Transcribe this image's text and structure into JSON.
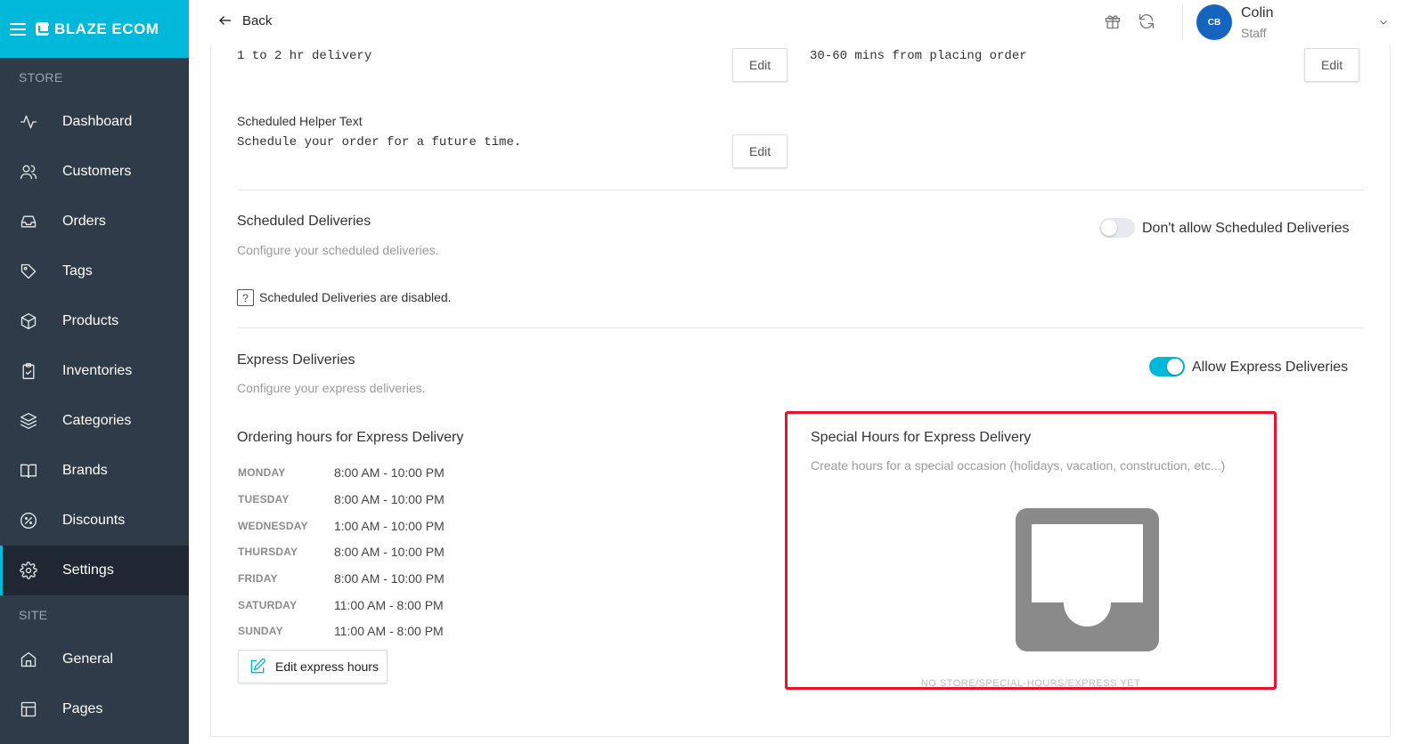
{
  "brand": {
    "name": "BLAZE ECOM"
  },
  "sidebar": {
    "store_label": "STORE",
    "site_label": "SITE",
    "store_items": [
      {
        "label": "Dashboard",
        "icon": "activity-icon"
      },
      {
        "label": "Customers",
        "icon": "users-icon"
      },
      {
        "label": "Orders",
        "icon": "inbox-icon"
      },
      {
        "label": "Tags",
        "icon": "tag-icon"
      },
      {
        "label": "Products",
        "icon": "box-icon"
      },
      {
        "label": "Inventories",
        "icon": "clipboard-check-icon"
      },
      {
        "label": "Categories",
        "icon": "layers-icon"
      },
      {
        "label": "Brands",
        "icon": "book-open-icon"
      },
      {
        "label": "Discounts",
        "icon": "percent-icon"
      },
      {
        "label": "Settings",
        "icon": "gear-icon",
        "active": true
      }
    ],
    "site_items": [
      {
        "label": "General",
        "icon": "home-icon"
      },
      {
        "label": "Pages",
        "icon": "layout-icon"
      }
    ]
  },
  "topbar": {
    "back_label": "Back",
    "user": {
      "initials": "CB",
      "name": "Colin",
      "role": "Staff"
    }
  },
  "content": {
    "top_row": {
      "left_text": "1 to 2 hr delivery",
      "right_text": "30-60 mins from placing order",
      "edit_label": "Edit"
    },
    "scheduled_helper": {
      "label": "Scheduled Helper Text",
      "text": "Schedule your order for a future time.",
      "edit_label": "Edit"
    },
    "scheduled_deliveries": {
      "title": "Scheduled Deliveries",
      "subtitle": "Configure your scheduled deliveries.",
      "toggle_label": "Don't allow Scheduled Deliveries",
      "toggle_on": false,
      "notice": "Scheduled Deliveries are disabled."
    },
    "express_deliveries": {
      "title": "Express Deliveries",
      "subtitle": "Configure your express deliveries.",
      "toggle_label": "Allow Express Deliveries",
      "toggle_on": true
    },
    "ordering_hours": {
      "title": "Ordering hours for Express Delivery",
      "days": [
        {
          "day": "MONDAY",
          "hours": "8:00 AM - 10:00 PM"
        },
        {
          "day": "TUESDAY",
          "hours": "8:00 AM - 10:00 PM"
        },
        {
          "day": "WEDNESDAY",
          "hours": "1:00 AM - 10:00 PM"
        },
        {
          "day": "THURSDAY",
          "hours": "8:00 AM - 10:00 PM"
        },
        {
          "day": "FRIDAY",
          "hours": "8:00 AM - 10:00 PM"
        },
        {
          "day": "SATURDAY",
          "hours": "11:00 AM - 8:00 PM"
        },
        {
          "day": "SUNDAY",
          "hours": "11:00 AM - 8:00 PM"
        }
      ],
      "edit_button": "Edit express hours"
    },
    "special_hours": {
      "title": "Special Hours for Express Delivery",
      "subtitle": "Create hours for a special occasion (holidays, vacation, construction, etc...)",
      "empty_text": "NO STORE/SPECIAL-HOURS/EXPRESS YET"
    }
  },
  "colors": {
    "accent": "#00b8d9",
    "sidebar_bg": "#2f3b49",
    "highlight": "#e8142a",
    "avatar": "#1565c0"
  }
}
